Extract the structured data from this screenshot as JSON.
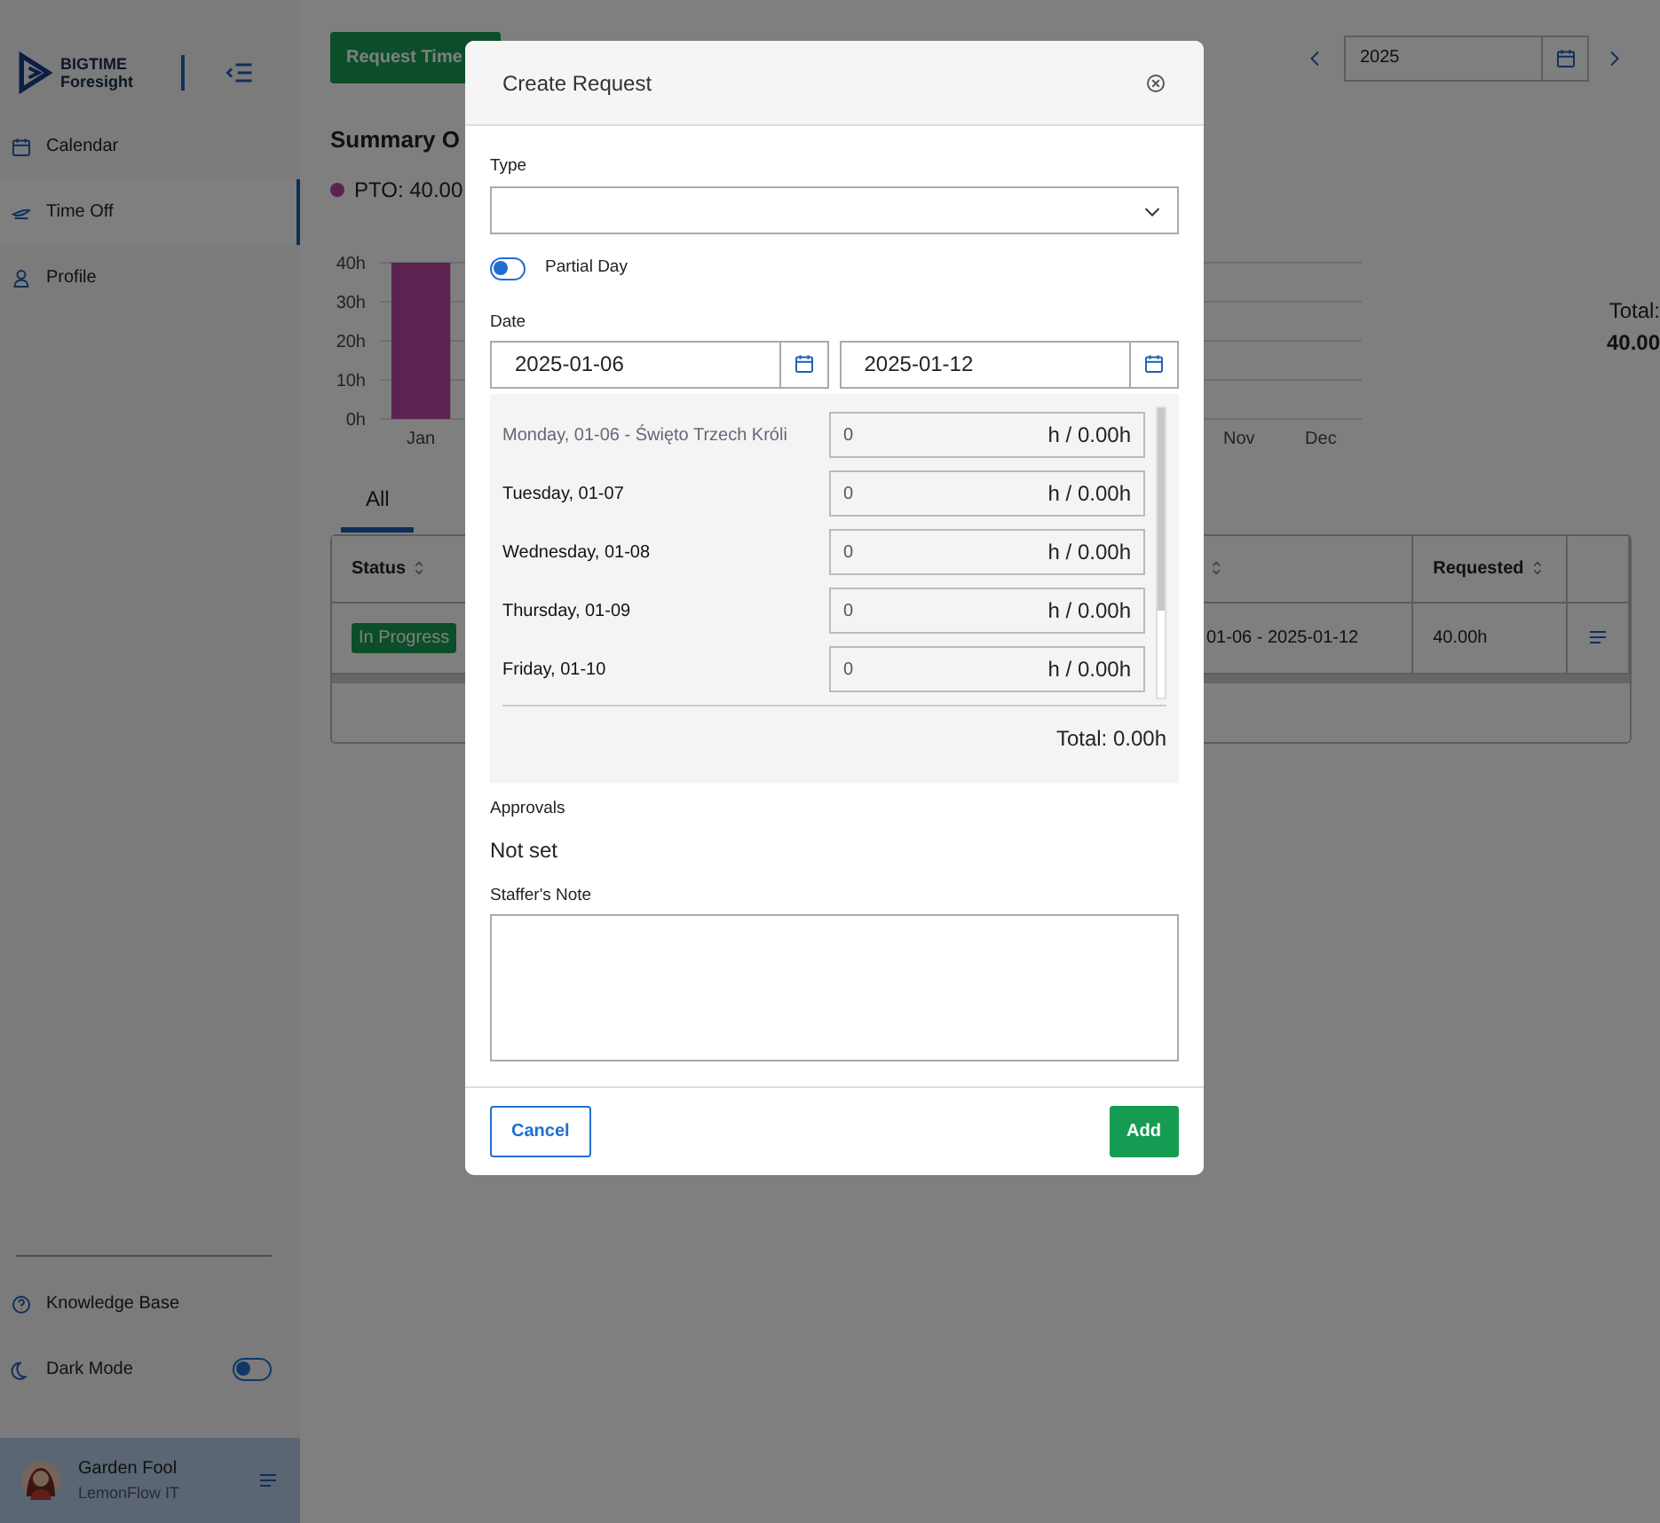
{
  "sidebar": {
    "logo": {
      "line_1": "BIGTIME",
      "line_2": "Foresight"
    },
    "items": [
      {
        "label": "Calendar",
        "selected": false
      },
      {
        "label": "Time Off",
        "selected": true
      },
      {
        "label": "Profile",
        "selected": false
      }
    ],
    "bottom_items": [
      {
        "label": "Knowledge Base",
        "kind": "link"
      },
      {
        "label": "Dark Mode",
        "kind": "toggle",
        "on": false
      }
    ],
    "user": {
      "name": "Garden Fool",
      "company": "LemonFlow IT"
    }
  },
  "main": {
    "request_button": "Request Time",
    "year": "2025",
    "summary_title": "Summary O",
    "legend": [
      {
        "label": "PTO: 40.00"
      }
    ],
    "chart_data": {
      "type": "bar",
      "grid": true,
      "categories": [
        "Jan",
        null,
        null,
        null,
        null,
        null,
        null,
        null,
        null,
        null,
        "Nov",
        "Dec"
      ],
      "ylim": [
        0,
        40
      ],
      "yticks": [
        {
          "value": 0,
          "label": "0h"
        },
        {
          "value": 10,
          "label": "10h"
        },
        {
          "value": 20,
          "label": "20h"
        },
        {
          "value": 30,
          "label": "30h"
        },
        {
          "value": 40,
          "label": "40h"
        }
      ],
      "series": [
        {
          "color": "#b446a0",
          "values": [
            40,
            null,
            null,
            null,
            null,
            null,
            null,
            null,
            null,
            null,
            0,
            0
          ]
        }
      ]
    },
    "total": {
      "label": "Total:",
      "value": "40.00"
    },
    "tabs": [
      {
        "label": "All",
        "selected": true
      }
    ],
    "table": {
      "columns": [
        {
          "label": "Status",
          "sortable": true
        },
        {
          "sortable": true
        },
        {
          "label": "Requested",
          "sortable": true
        },
        {
          "sortable": false
        }
      ],
      "rows": [
        {
          "status": "In Progress",
          "dates": "01-06 - 2025-01-12",
          "requested": "40.00h"
        }
      ]
    }
  },
  "dialog": {
    "title": "Create Request",
    "type_label": "Type",
    "partial_day": {
      "label": "Partial Day",
      "on": false
    },
    "date_label": "Date",
    "start_date": "2025-01-06",
    "end_date": "2025-01-12",
    "days": [
      {
        "label": "Monday, 01-06 - Święto Trzech Króli",
        "holiday": true,
        "hours": "0",
        "suffix": "h / 0.00h"
      },
      {
        "label": "Tuesday, 01-07",
        "holiday": false,
        "hours": "0",
        "suffix": "h / 0.00h"
      },
      {
        "label": "Wednesday, 01-08",
        "holiday": false,
        "hours": "0",
        "suffix": "h / 0.00h"
      },
      {
        "label": "Thursday, 01-09",
        "holiday": false,
        "hours": "0",
        "suffix": "h / 0.00h"
      },
      {
        "label": "Friday, 01-10",
        "holiday": false,
        "hours": "0",
        "suffix": "h / 0.00h"
      }
    ],
    "total": "Total: 0.00h",
    "approvals_label": "Approvals",
    "approvals_value": "Not set",
    "note_label": "Staffer's Note",
    "buttons": [
      {
        "label": "Cancel",
        "kind": "secondary"
      },
      {
        "label": "Add",
        "kind": "primary"
      }
    ]
  }
}
